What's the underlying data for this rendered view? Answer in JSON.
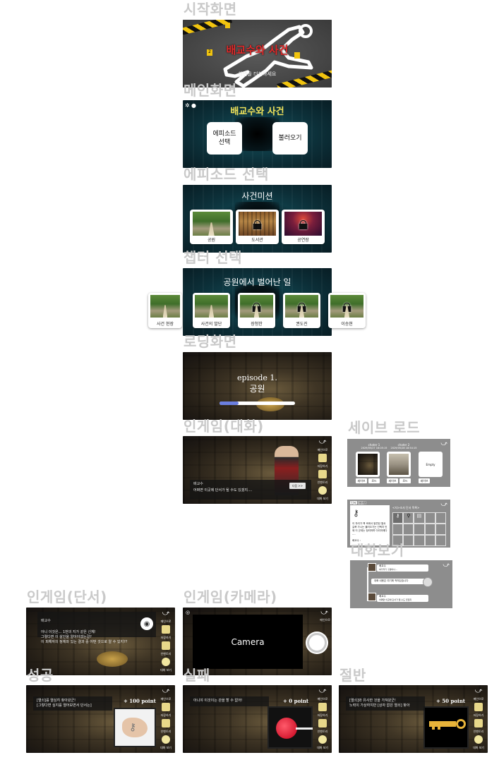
{
  "sections": {
    "start": "시작화면",
    "main": "메인화면",
    "episode_select": "에피소드 선택",
    "chapter_select": "챕터 선택",
    "loading": "로딩화면",
    "ingame_dialog": "인게임(대화)",
    "save_load": "세이브 로드",
    "dialog_view": "대화보기",
    "ingame_clue": "인게임(단서)",
    "ingame_camera": "인게임(카메라)",
    "success": "성공",
    "fail": "실패",
    "half": "절반"
  },
  "start_screen": {
    "title": "배교수와 사건",
    "subtitle": "화면을 터치하세요"
  },
  "main_screen": {
    "title": "배교수와 사건",
    "episode_button": "에피소드\n선택",
    "load_button": "불러오기"
  },
  "episode_screen": {
    "title": "사건미션",
    "episodes": [
      {
        "label": "공원",
        "locked": false
      },
      {
        "label": "도서관",
        "locked": true
      },
      {
        "label": "공연장",
        "locked": true
      }
    ]
  },
  "chapter_screen": {
    "title": "공원에서 벌어난 일",
    "chapters": [
      {
        "label": "사건 현장",
        "locked": false
      },
      {
        "label": "사건의 발단",
        "locked": false
      },
      {
        "label": "장청한",
        "locked": true
      },
      {
        "label": "권도진",
        "locked": true
      },
      {
        "label": "이승현",
        "locked": true
      }
    ]
  },
  "loading_screen": {
    "episode": "episode 1.",
    "name": "공원",
    "progress": 0.25
  },
  "side_menu": {
    "items": [
      "메인으로",
      "저장하기",
      "인벤토리",
      "대화 보기"
    ]
  },
  "ingame_dialog": {
    "speaker": "배교수",
    "text": "어쩌면 이곳에 단서가 될 수도 있겠지....",
    "next": "다음 >>"
  },
  "save_load": {
    "slots": [
      {
        "title": "chater 1",
        "date": "2029/05/27 16:05:15",
        "buttons": [
          "세이브",
          "로드"
        ]
      },
      {
        "title": "chater 2",
        "date": "2029/05/28 18:54:15",
        "buttons": [
          "세이브",
          "로드"
        ]
      },
      {
        "title": "Empty",
        "date": "",
        "buttons": [
          "세이브"
        ]
      }
    ]
  },
  "inventory": {
    "tabs": [
      "단서",
      "아이템"
    ],
    "header": "<자>조사 단서 목록>",
    "desc": "이 자리가 책 속에서 발견된 열쇠\n길쭉 가시는 불러오기는 선택지 인제 이 군데는 정리하며 이리저에다 ….",
    "note": "배교수 :"
  },
  "dialog_view": {
    "entries": [
      {
        "name": "배교수",
        "text": "여기저기 구경이나..."
      },
      {
        "name": "",
        "text": "대화 내용은 여기에 적혀있습니다"
      },
      {
        "name": "배교수",
        "text": "어쩌면 이곳에 단서가 될 수도 있겠지"
      }
    ]
  },
  "ingame_clue": {
    "speaker": "배교수",
    "text": "아니 이것은... 1번의 지가 같은 신체!\n그렇다면 이 살인을 알아야겠는걸?\n이 피해자의 정체와 있는 결과 중 어떤 것으로 알 수 있지??"
  },
  "ingame_camera": {
    "label": "Camera"
  },
  "success": {
    "points": "+ 100 point",
    "text": "[열쇠]를 열심히 찾아왔군!\n[그렇다면 싶지를 열어보면서 단서는]"
  },
  "fail": {
    "points": "+ 0 point",
    "text": "아니야 이것이는 관을 할 수 없어!"
  },
  "half": {
    "points": "+ 50 point",
    "text": "[열쇠]와 유사한 것을 가져왔군!\n노력이 가상하지만 [상자 없은 열쇠] 찾아"
  },
  "colors": {
    "title_red": "#e02a2a",
    "title_yellow": "#f2e45a",
    "progress": "#6b7fe0"
  }
}
